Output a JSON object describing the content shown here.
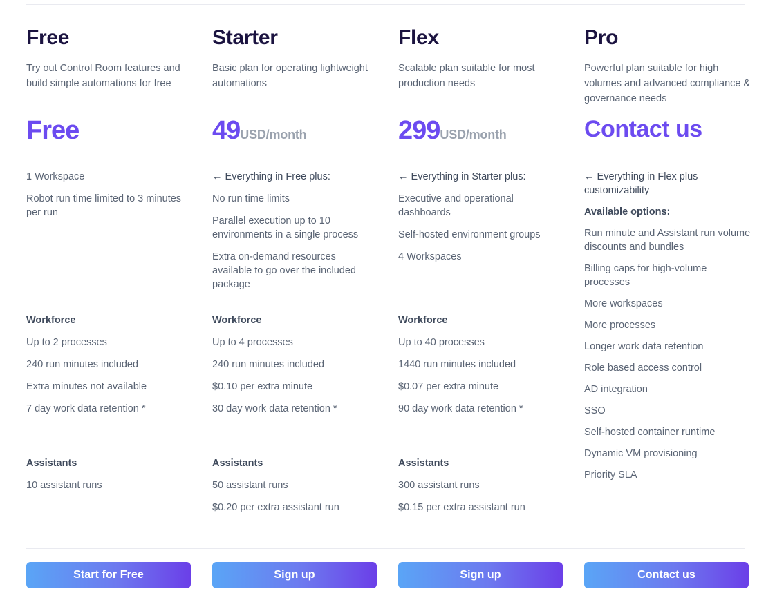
{
  "plans": [
    {
      "name": "Free",
      "description": "Try out Control Room features and build simple automations for free",
      "price_amount": "Free",
      "price_unit": "",
      "features": [
        "1 Workspace",
        "Robot run time limited to 3 minutes per run"
      ],
      "workforce": {
        "title": "Workforce",
        "items": [
          "Up to 2 processes",
          "240 run minutes included",
          "Extra minutes not available",
          "7 day work data retention *"
        ]
      },
      "assistants": {
        "title": "Assistants",
        "items": [
          "10 assistant runs"
        ]
      },
      "cta_label": "Start for Free"
    },
    {
      "name": "Starter",
      "description": "Basic plan for operating lightweight automations",
      "price_amount": "49",
      "price_unit": "USD/month",
      "features": [
        "← Everything in Free plus:",
        "No run time limits",
        "Parallel execution up to 10 environments in a single process",
        "Extra on-demand resources available to go over the included package"
      ],
      "workforce": {
        "title": "Workforce",
        "items": [
          "Up to 4 processes",
          "240 run minutes included",
          "$0.10 per extra minute",
          "30 day work data retention *"
        ]
      },
      "assistants": {
        "title": "Assistants",
        "items": [
          "50 assistant runs",
          "$0.20 per extra assistant run"
        ]
      },
      "cta_label": "Sign up"
    },
    {
      "name": "Flex",
      "description": "Scalable plan suitable for most production needs",
      "price_amount": "299",
      "price_unit": "USD/month",
      "features": [
        "← Everything in Starter plus:",
        "Executive and operational dashboards",
        "Self-hosted environment groups",
        "4 Workspaces"
      ],
      "workforce": {
        "title": "Workforce",
        "items": [
          "Up to 40 processes",
          "1440 run minutes included",
          "$0.07 per extra minute",
          "90 day work data retention *"
        ]
      },
      "assistants": {
        "title": "Assistants",
        "items": [
          "300 assistant runs",
          "$0.15 per extra assistant run"
        ]
      },
      "cta_label": "Sign up"
    },
    {
      "name": "Pro",
      "description": "Powerful plan suitable for high volumes and advanced compliance & governance needs",
      "price_amount": "Contact us",
      "price_unit": "",
      "features": [
        "← Everything in Flex plus customizability",
        "Available options:",
        "Run minute and Assistant run volume discounts and bundles",
        "Billing caps for high-volume processes",
        "More workspaces",
        "More processes",
        "Longer work data retention",
        "Role based access control",
        "AD integration",
        "SSO",
        "Self-hosted container runtime",
        "Dynamic VM provisioning",
        "Priority SLA"
      ],
      "cta_label": "Contact us"
    }
  ],
  "colors": {
    "price_purple": "#6c4bf0",
    "heading_navy": "#1b1340",
    "body_gray": "#5a6474",
    "unit_gray": "#9aa2ae",
    "rule": "#e9eaf0",
    "cta_gradient_start": "#5aa5f6",
    "cta_gradient_end": "#6b3fe8"
  }
}
